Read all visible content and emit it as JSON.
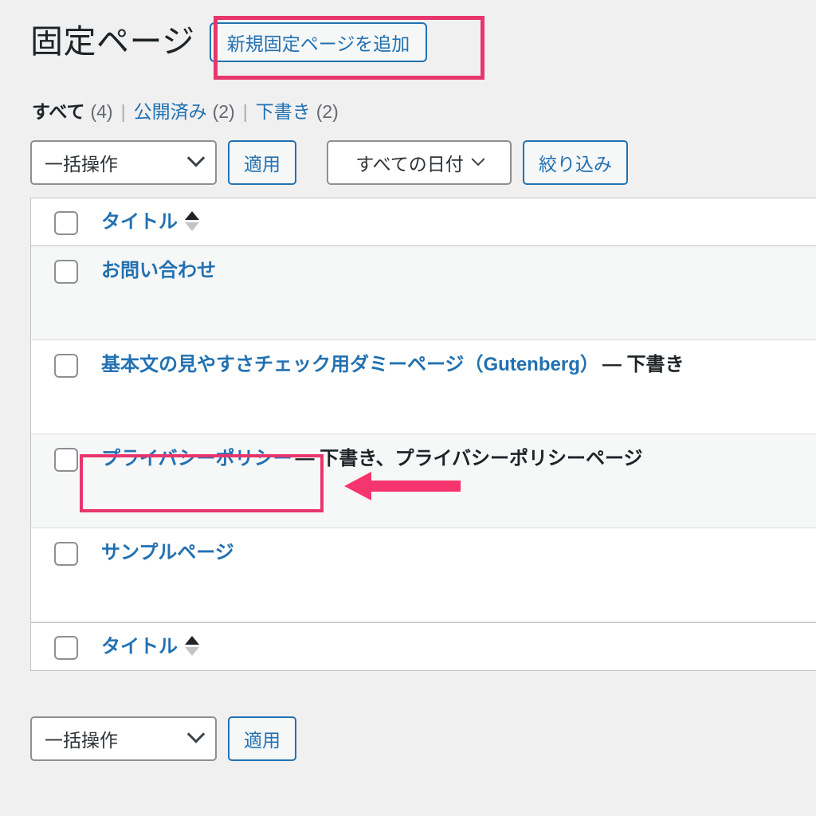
{
  "header": {
    "title": "固定ページ",
    "add_new_label": "新規固定ページを追加"
  },
  "status_links": [
    {
      "label": "すべて",
      "count": "(4)",
      "current": true
    },
    {
      "label": "公開済み",
      "count": "(2)",
      "current": false
    },
    {
      "label": "下書き",
      "count": "(2)",
      "current": false
    }
  ],
  "separator": "|",
  "toolbar_top": {
    "bulk_action_value": "一括操作",
    "apply_label": "適用",
    "date_filter_value": "すべての日付",
    "filter_label": "絞り込み"
  },
  "toolbar_bottom": {
    "bulk_action_value": "一括操作",
    "apply_label": "適用"
  },
  "table": {
    "column_title": "タイトル",
    "rows": [
      {
        "title": "お問い合わせ",
        "state": "",
        "stripe": true
      },
      {
        "title": "基本文の見やすさチェック用ダミーページ（Gutenberg）",
        "state": "— 下書き",
        "stripe": false
      },
      {
        "title": "プライバシーポリシー",
        "state": "— 下書き、プライバシーポリシーページ",
        "stripe": true
      },
      {
        "title": "サンプルページ",
        "state": "",
        "stripe": false
      }
    ]
  },
  "annotations": {
    "accent_color": "#e8366d",
    "box_add_new": "新規固定ページを追加",
    "box_privacy": "プライバシーポリシー",
    "arrow_direction": "left"
  },
  "colors": {
    "link": "#2271b1",
    "text": "#1d2327",
    "muted": "#646970",
    "page_bg": "#f0f0f1",
    "stripe_bg": "#f6f7f7",
    "border": "#c3c4c7"
  }
}
